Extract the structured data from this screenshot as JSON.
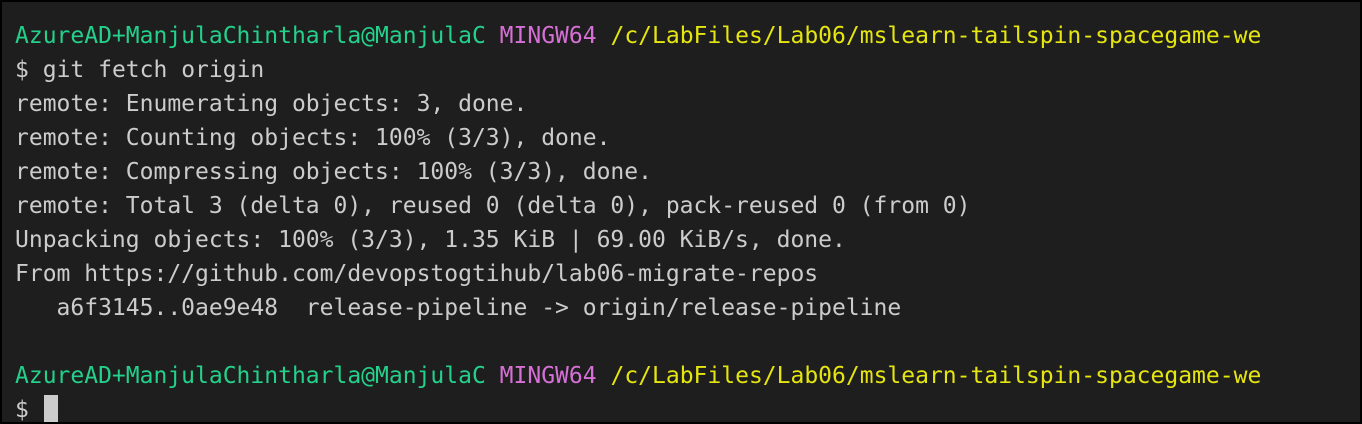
{
  "prompt": {
    "user": "AzureAD+ManjulaChintharla@ManjulaC",
    "system": "MINGW64",
    "path": "/c/LabFiles/Lab06/mslearn-tailspin-spacegame-we",
    "symbol": "$"
  },
  "command": "git fetch origin",
  "output": [
    "remote: Enumerating objects: 3, done.",
    "remote: Counting objects: 100% (3/3), done.",
    "remote: Compressing objects: 100% (3/3), done.",
    "remote: Total 3 (delta 0), reused 0 (delta 0), pack-reused 0 (from 0)",
    "Unpacking objects: 100% (3/3), 1.35 KiB | 69.00 KiB/s, done.",
    "From https://github.com/devopstogtihub/lab06-migrate-repos",
    "   a6f3145..0ae9e48  release-pipeline -> origin/release-pipeline"
  ],
  "colors": {
    "background": "#1e1e1e",
    "text": "#cccccc",
    "user": "#23d18b",
    "system": "#d670d6",
    "path": "#e5e510"
  }
}
